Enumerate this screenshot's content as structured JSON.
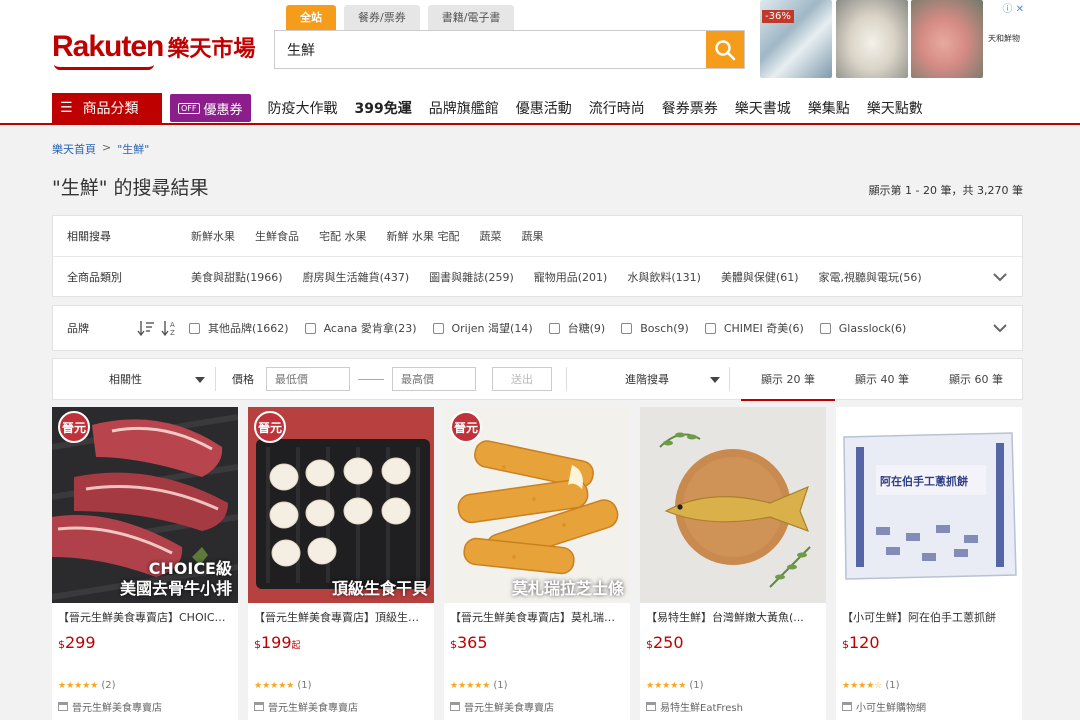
{
  "header": {
    "logo_en": "Rakuten",
    "logo_zh": "樂天市場",
    "search_tabs": [
      {
        "label": "全站",
        "active": true
      },
      {
        "label": "餐券/票券",
        "active": false
      },
      {
        "label": "書籍/電子書",
        "active": false
      }
    ],
    "search_value": "生鮮",
    "ad": {
      "discount_badge": "-36%",
      "brand": "天和鮮物"
    },
    "category_button": "商品分類",
    "coupon_tag": "OFF",
    "coupon_button": "優惠券",
    "nav_links": [
      "防疫大作戰",
      "399免運",
      "品牌旗艦館",
      "優惠活動",
      "流行時尚",
      "餐券票券",
      "樂天書城",
      "樂集點",
      "樂天點數"
    ]
  },
  "breadcrumb": {
    "home": "樂天首頁",
    "sep": ">",
    "current": "\"生鮮\""
  },
  "page_title": "\"生鮮\" 的搜尋結果",
  "result_count": "顯示第 1 - 20 筆，共 3,270 筆",
  "filters": {
    "related": {
      "label": "相關搜尋",
      "items": [
        "新鮮水果",
        "生鮮食品",
        "宅配 水果",
        "新鮮 水果 宅配",
        "蔬菜",
        "蔬果"
      ]
    },
    "categories": {
      "label": "全商品類別",
      "items": [
        "美食與甜點(1966)",
        "廚房與生活雜貨(437)",
        "圖書與雜誌(259)",
        "寵物用品(201)",
        "水與飲料(131)",
        "美體與保健(61)",
        "家電,視聽與電玩(56)"
      ]
    },
    "brand": {
      "label": "品牌",
      "items": [
        "其他品牌(1662)",
        "Acana 愛肯拿(23)",
        "Orijen 渴望(14)",
        "台糖(9)",
        "Bosch(9)",
        "CHIMEI 奇美(6)",
        "Glasslock(6)"
      ]
    }
  },
  "toolbar": {
    "sort": "相關性",
    "price_label": "價格",
    "min_placeholder": "最低價",
    "max_placeholder": "最高價",
    "submit": "送出",
    "advanced": "進階搜尋",
    "per_page": [
      "顯示 20 筆",
      "顯示 40 筆",
      "顯示 60 筆"
    ]
  },
  "products": [
    {
      "title": "【晉元生鮮美食專賣店】CHOICE級美國去骨牛小排",
      "currency": "$",
      "price": "299",
      "suffix": "",
      "stars": "★★★★★",
      "reviews": "(2)",
      "shop": "晉元生鮮美食專賣店",
      "caption1": "CHOICE級",
      "caption2": "美國去骨牛小排",
      "badge": "晉元"
    },
    {
      "title": "【晉元生鮮美食專賣店】頂級生食干貝",
      "currency": "$",
      "price": "199",
      "suffix": "起",
      "stars": "★★★★★",
      "reviews": "(1)",
      "shop": "晉元生鮮美食專賣店",
      "caption1": "頂級生食干貝",
      "caption2": "",
      "badge": "晉元"
    },
    {
      "title": "【晉元生鮮美食專賣店】莫札瑞拉芝士條",
      "currency": "$",
      "price": "365",
      "suffix": "",
      "stars": "★★★★★",
      "reviews": "(1)",
      "shop": "晉元生鮮美食專賣店",
      "caption1": "莫札瑞拉芝士條",
      "caption2": "",
      "badge": "晉元"
    },
    {
      "title": "【易特生鮮】台灣鮮嫩大黃魚(...",
      "currency": "$",
      "price": "250",
      "suffix": "",
      "stars": "★★★★★",
      "reviews": "(1)",
      "shop": "易特生鮮EatFresh",
      "caption1": "",
      "caption2": "",
      "badge": ""
    },
    {
      "title": "【小可生鮮】阿在伯手工蔥抓餅",
      "currency": "$",
      "price": "120",
      "suffix": "",
      "stars": "★★★★☆",
      "reviews": "(1)",
      "shop": "小可生鮮購物網",
      "caption1": "",
      "caption2": "",
      "badge": "",
      "pack_text": "阿在伯手工蔥抓餅"
    }
  ]
}
